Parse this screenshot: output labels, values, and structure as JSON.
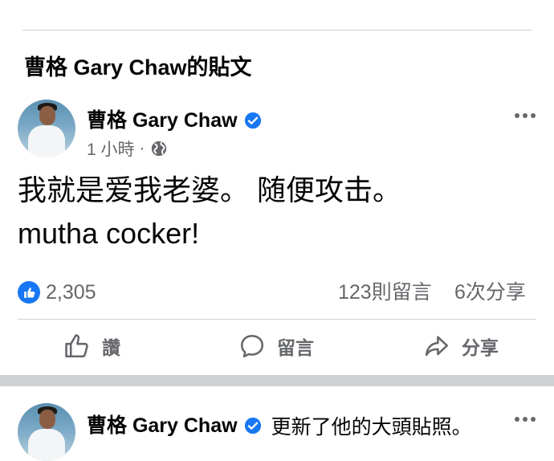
{
  "section_title": "曹格 Gary Chaw的貼文",
  "post": {
    "author": "曹格 Gary Chaw",
    "time": "1 小時",
    "separator": "·",
    "privacy_icon": "globe-icon",
    "text_line1": "我就是爱我老婆。 随便攻击。",
    "text_line2": "mutha cocker!",
    "reaction_icon": "like-icon",
    "reaction_count": "2,305",
    "comments": "123則留言",
    "shares": "6次分享"
  },
  "actions": {
    "like": "讚",
    "comment": "留言",
    "share": "分享"
  },
  "next_post": {
    "author": "曹格 Gary Chaw",
    "activity": "更新了他的大頭貼照。"
  },
  "colors": {
    "accent": "#1877f2",
    "muted": "#65676b",
    "divider": "#ced0d4"
  }
}
